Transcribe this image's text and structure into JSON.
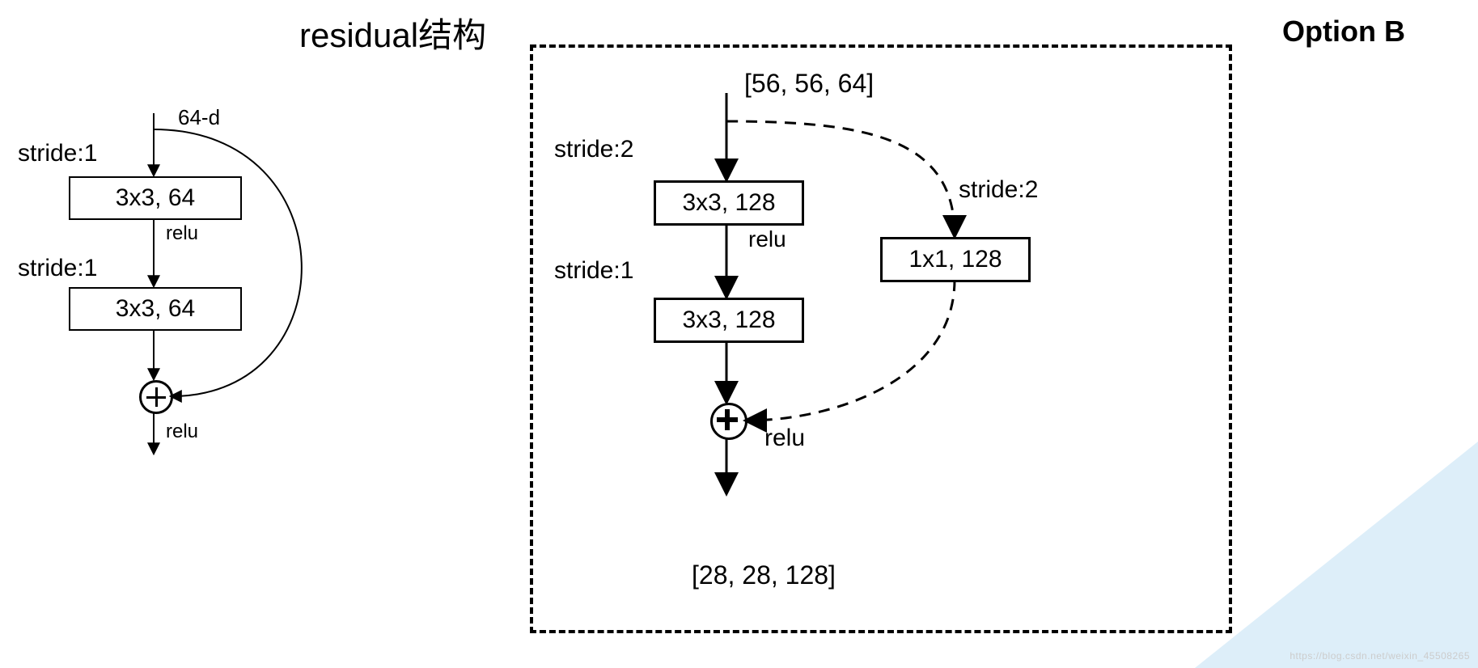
{
  "title": "residual结构",
  "option_b_label": "Option B",
  "left": {
    "stride1_a": "stride:1",
    "stride1_b": "stride:1",
    "input_label": "64-d",
    "conv1": "3x3, 64",
    "conv2": "3x3, 64",
    "relu_mid": "relu",
    "relu_out": "relu"
  },
  "right": {
    "input_shape": "[56, 56, 64]",
    "output_shape": "[28, 28, 128]",
    "stride2_a": "stride:2",
    "stride1_b": "stride:1",
    "stride2_c": "stride:2",
    "conv1": "3x3, 128",
    "conv2": "3x3, 128",
    "conv_shortcut": "1x1, 128",
    "relu_mid": "relu",
    "relu_out": "relu"
  },
  "watermark": "https://blog.csdn.net/weixin_45508265"
}
